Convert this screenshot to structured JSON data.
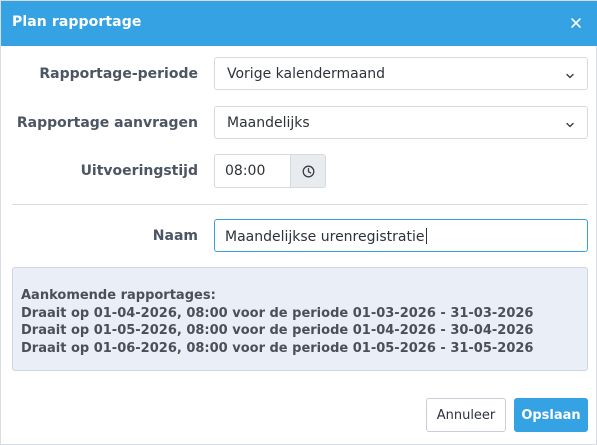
{
  "dialog": {
    "title": "Plan rapportage",
    "close_icon": "close-icon"
  },
  "form": {
    "period": {
      "label": "Rapportage-periode",
      "value": "Vorige kalendermaand"
    },
    "frequency": {
      "label": "Rapportage aanvragen",
      "value": "Maandelijks"
    },
    "time": {
      "label": "Uitvoeringstijd",
      "value": "08:00",
      "icon": "clock-icon"
    },
    "name": {
      "label": "Naam",
      "value": "Maandelijkse urenregistratie"
    }
  },
  "upcoming": {
    "heading": "Aankomende rapportages:",
    "items": [
      "Draait op 01-04-2026, 08:00 voor de periode 01-03-2026 - 31-03-2026",
      "Draait op 01-05-2026, 08:00 voor de periode 01-04-2026 - 30-04-2026",
      "Draait op 01-06-2026, 08:00 voor de periode 01-05-2026 - 31-05-2026"
    ]
  },
  "buttons": {
    "cancel": "Annuleer",
    "save": "Opslaan"
  },
  "colors": {
    "accent": "#35a2e3",
    "info_background": "#eaeef6"
  }
}
